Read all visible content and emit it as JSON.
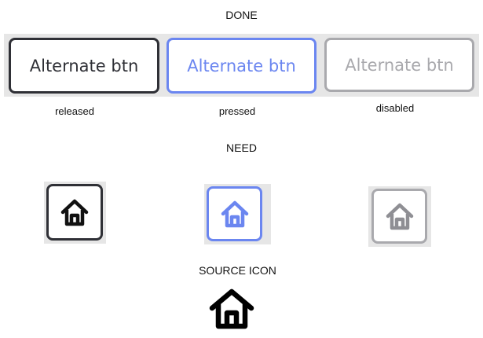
{
  "sections": {
    "done": "DONE",
    "need": "NEED",
    "source": "SOURCE ICON"
  },
  "buttons": {
    "label": "Alternate btn",
    "states": {
      "released": "released",
      "pressed": "pressed",
      "disabled": "disabled"
    }
  },
  "colors": {
    "released": "#2f3036",
    "pressed": "#6b86f0",
    "disabled": "#a9a9ad",
    "preview_bg": "#e6e6e6"
  },
  "icons": {
    "home": "home-icon"
  }
}
